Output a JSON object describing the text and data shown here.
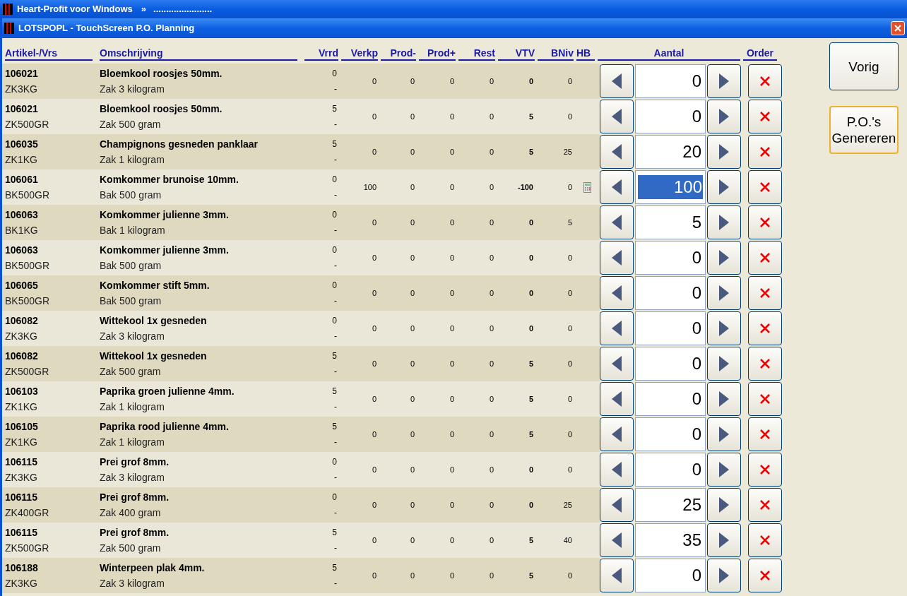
{
  "app_title": {
    "text": "Heart-Profit voor Windows",
    "separator": "»",
    "suffix": "......................."
  },
  "window": {
    "title": "LOTSPOPL - TouchScreen P.O. Planning"
  },
  "columns": [
    "Artikel-/Vrs",
    "Omschrijving",
    "Vrrd",
    "Verkp",
    "Prod-",
    "Prod+",
    "Rest",
    "VTV",
    "BNiv",
    "HB",
    "Aantal",
    "Order"
  ],
  "rows": [
    {
      "code": "106021",
      "variant": "ZK3KG",
      "description": "Bloemkool roosjes 50mm.",
      "unit": "Zak 3 kilogram",
      "vrrd": "0",
      "vrrd_sub": "-",
      "verkp": "0",
      "prod_min": "0",
      "prod_plus": "0",
      "rest": "0",
      "vtv": "0",
      "bniv": "0",
      "hb": false,
      "aantal": "0",
      "selected": false
    },
    {
      "code": "106021",
      "variant": "ZK500GR",
      "description": "Bloemkool roosjes 50mm.",
      "unit": "Zak 500 gram",
      "vrrd": "5",
      "vrrd_sub": "-",
      "verkp": "0",
      "prod_min": "0",
      "prod_plus": "0",
      "rest": "0",
      "vtv": "5",
      "bniv": "0",
      "hb": false,
      "aantal": "0",
      "selected": false
    },
    {
      "code": "106035",
      "variant": "ZK1KG",
      "description": "Champignons gesneden panklaar",
      "unit": "Zak 1 kilogram",
      "vrrd": "5",
      "vrrd_sub": "-",
      "verkp": "0",
      "prod_min": "0",
      "prod_plus": "0",
      "rest": "0",
      "vtv": "5",
      "bniv": "25",
      "hb": false,
      "aantal": "20",
      "selected": false
    },
    {
      "code": "106061",
      "variant": "BK500GR",
      "description": "Komkommer brunoise 10mm.",
      "unit": "Bak 500 gram",
      "vrrd": "0",
      "vrrd_sub": "-",
      "verkp": "100",
      "prod_min": "0",
      "prod_plus": "0",
      "rest": "0",
      "vtv": "-100",
      "bniv": "0",
      "hb": true,
      "aantal": "100",
      "selected": true
    },
    {
      "code": "106063",
      "variant": "BK1KG",
      "description": "Komkommer julienne 3mm.",
      "unit": "Bak 1 kilogram",
      "vrrd": "0",
      "vrrd_sub": "-",
      "verkp": "0",
      "prod_min": "0",
      "prod_plus": "0",
      "rest": "0",
      "vtv": "0",
      "bniv": "5",
      "hb": false,
      "aantal": "5",
      "selected": false
    },
    {
      "code": "106063",
      "variant": "BK500GR",
      "description": "Komkommer julienne 3mm.",
      "unit": "Bak 500 gram",
      "vrrd": "0",
      "vrrd_sub": "-",
      "verkp": "0",
      "prod_min": "0",
      "prod_plus": "0",
      "rest": "0",
      "vtv": "0",
      "bniv": "0",
      "hb": false,
      "aantal": "0",
      "selected": false
    },
    {
      "code": "106065",
      "variant": "BK500GR",
      "description": "Komkommer stift 5mm.",
      "unit": "Bak 500 gram",
      "vrrd": "0",
      "vrrd_sub": "-",
      "verkp": "0",
      "prod_min": "0",
      "prod_plus": "0",
      "rest": "0",
      "vtv": "0",
      "bniv": "0",
      "hb": false,
      "aantal": "0",
      "selected": false
    },
    {
      "code": "106082",
      "variant": "ZK3KG",
      "description": "Wittekool 1x gesneden",
      "unit": "Zak 3 kilogram",
      "vrrd": "0",
      "vrrd_sub": "-",
      "verkp": "0",
      "prod_min": "0",
      "prod_plus": "0",
      "rest": "0",
      "vtv": "0",
      "bniv": "0",
      "hb": false,
      "aantal": "0",
      "selected": false
    },
    {
      "code": "106082",
      "variant": "ZK500GR",
      "description": "Wittekool 1x gesneden",
      "unit": "Zak 500 gram",
      "vrrd": "5",
      "vrrd_sub": "-",
      "verkp": "0",
      "prod_min": "0",
      "prod_plus": "0",
      "rest": "0",
      "vtv": "5",
      "bniv": "0",
      "hb": false,
      "aantal": "0",
      "selected": false
    },
    {
      "code": "106103",
      "variant": "ZK1KG",
      "description": "Paprika groen julienne 4mm.",
      "unit": "Zak 1 kilogram",
      "vrrd": "5",
      "vrrd_sub": "-",
      "verkp": "0",
      "prod_min": "0",
      "prod_plus": "0",
      "rest": "0",
      "vtv": "5",
      "bniv": "0",
      "hb": false,
      "aantal": "0",
      "selected": false
    },
    {
      "code": "106105",
      "variant": "ZK1KG",
      "description": "Paprika rood julienne 4mm.",
      "unit": "Zak 1 kilogram",
      "vrrd": "5",
      "vrrd_sub": "-",
      "verkp": "0",
      "prod_min": "0",
      "prod_plus": "0",
      "rest": "0",
      "vtv": "5",
      "bniv": "0",
      "hb": false,
      "aantal": "0",
      "selected": false
    },
    {
      "code": "106115",
      "variant": "ZK3KG",
      "description": "Prei grof 8mm.",
      "unit": "Zak 3 kilogram",
      "vrrd": "0",
      "vrrd_sub": "-",
      "verkp": "0",
      "prod_min": "0",
      "prod_plus": "0",
      "rest": "0",
      "vtv": "0",
      "bniv": "0",
      "hb": false,
      "aantal": "0",
      "selected": false
    },
    {
      "code": "106115",
      "variant": "ZK400GR",
      "description": "Prei grof 8mm.",
      "unit": "Zak 400 gram",
      "vrrd": "0",
      "vrrd_sub": "-",
      "verkp": "0",
      "prod_min": "0",
      "prod_plus": "0",
      "rest": "0",
      "vtv": "0",
      "bniv": "25",
      "hb": false,
      "aantal": "25",
      "selected": false
    },
    {
      "code": "106115",
      "variant": "ZK500GR",
      "description": "Prei grof 8mm.",
      "unit": "Zak 500 gram",
      "vrrd": "5",
      "vrrd_sub": "-",
      "verkp": "0",
      "prod_min": "0",
      "prod_plus": "0",
      "rest": "0",
      "vtv": "5",
      "bniv": "40",
      "hb": false,
      "aantal": "35",
      "selected": false
    },
    {
      "code": "106188",
      "variant": "ZK3KG",
      "description": "Winterpeen plak 4mm.",
      "unit": "Zak 3 kilogram",
      "vrrd": "5",
      "vrrd_sub": "-",
      "verkp": "0",
      "prod_min": "0",
      "prod_plus": "0",
      "rest": "0",
      "vtv": "5",
      "bniv": "0",
      "hb": false,
      "aantal": "0",
      "selected": false
    }
  ],
  "side_buttons": [
    {
      "lines": [
        "Vorig"
      ],
      "focused": false
    },
    {
      "lines": [
        "P.O.'s",
        "Genereren"
      ],
      "focused": true
    }
  ]
}
